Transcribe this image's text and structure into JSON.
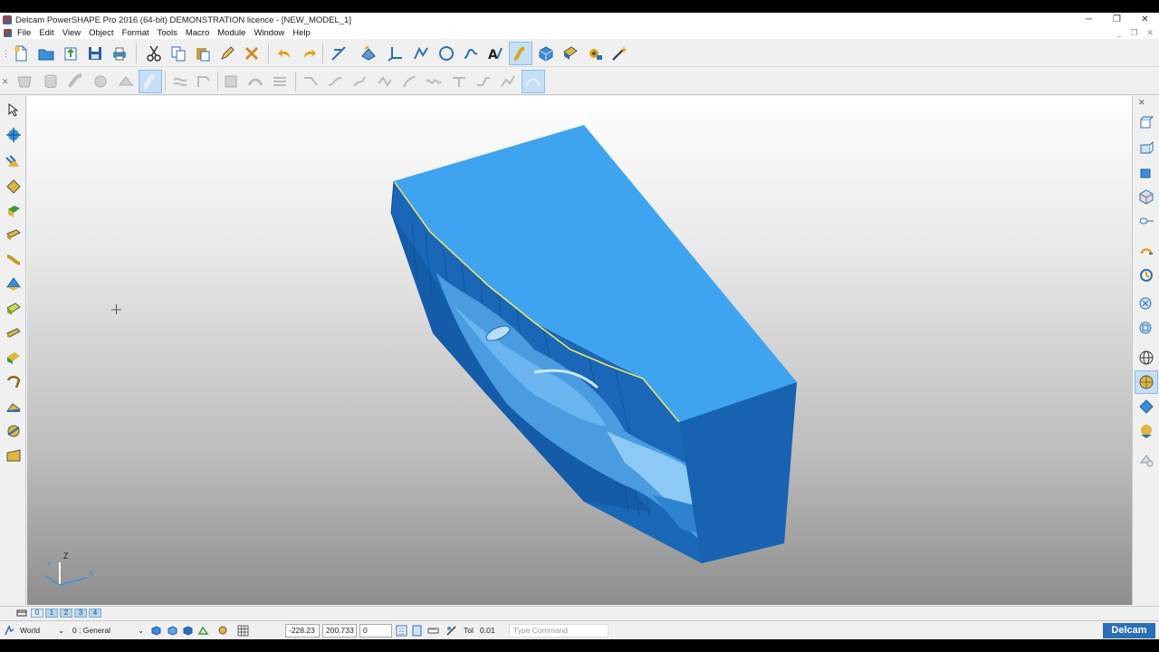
{
  "window": {
    "title": "Delcam PowerSHAPE Pro 2016 (64-bit) DEMONSTRATION licence - [NEW_MODEL_1]",
    "controls": [
      "─",
      "❐",
      "✕"
    ],
    "mdi_controls": [
      "_",
      "❐",
      "✕"
    ]
  },
  "menu": [
    "File",
    "Edit",
    "View",
    "Object",
    "Format",
    "Tools",
    "Macro",
    "Module",
    "Window",
    "Help"
  ],
  "layers": {
    "tabs": [
      "0",
      "1",
      "2",
      "3",
      "4"
    ]
  },
  "status": {
    "workplane": "World",
    "level": "0  : General",
    "x": "-228.23",
    "y": "200.733",
    "z": "0",
    "tol_label": "Tol",
    "tol_value": "0.01",
    "command_placeholder": "Type Command",
    "brand": "Delcam"
  },
  "axes": {
    "z": "Z",
    "y": "Y",
    "x": "X"
  },
  "colors": {
    "model_top": "#3fa4f0",
    "model_side": "#1a67b8",
    "model_dark": "#0f4f94",
    "highlight_edge": "#f5e663",
    "toolbar_bg": "#f0f0f0",
    "brand_blue": "#2a6fb8"
  }
}
